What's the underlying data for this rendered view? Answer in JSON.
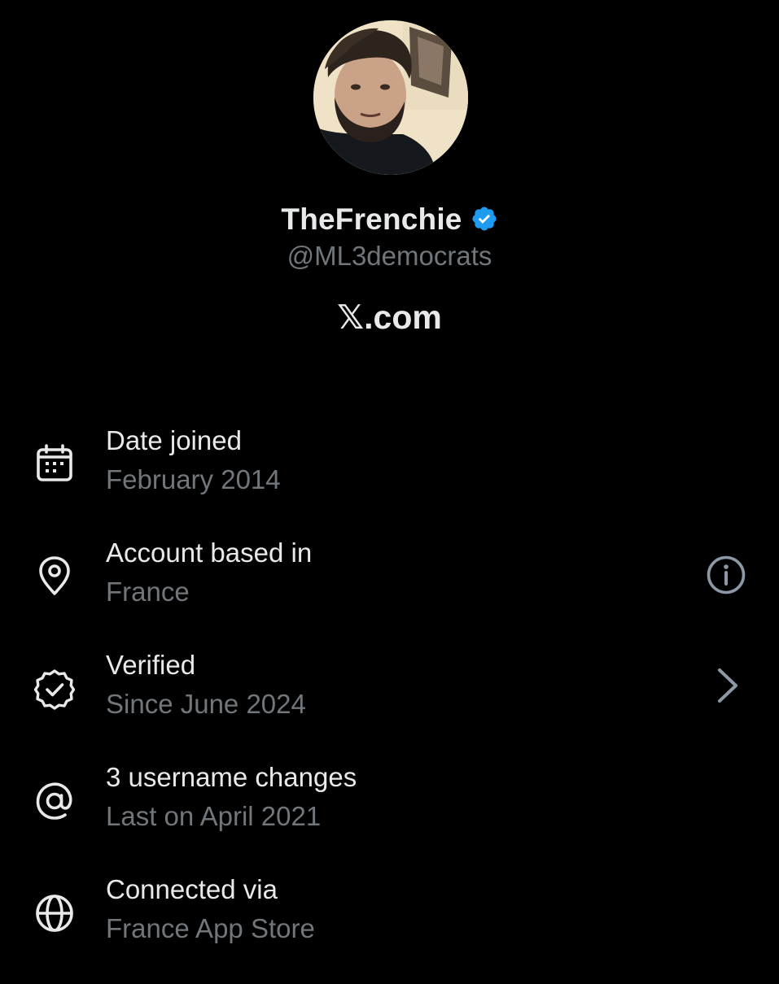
{
  "profile": {
    "display_name": "TheFrenchie",
    "handle": "@ML3democrats",
    "platform": "𝕏.com",
    "verified": true,
    "badge_color": "#1d9bf0"
  },
  "rows": [
    {
      "label": "Date joined",
      "value": "February 2014",
      "icon": "calendar-icon"
    },
    {
      "label": "Account based in",
      "value": "France",
      "icon": "location-pin-icon",
      "action": "info-icon"
    },
    {
      "label": "Verified",
      "value": "Since June 2024",
      "icon": "verified-badge-icon",
      "action": "chevron-right-icon"
    },
    {
      "label": "3 username changes",
      "value": "Last on April 2021",
      "icon": "at-sign-icon"
    },
    {
      "label": "Connected via",
      "value": "France App Store",
      "icon": "globe-icon"
    }
  ],
  "colors": {
    "background": "#000000",
    "primary_text": "#e7e9ea",
    "secondary_text": "#71767b"
  }
}
